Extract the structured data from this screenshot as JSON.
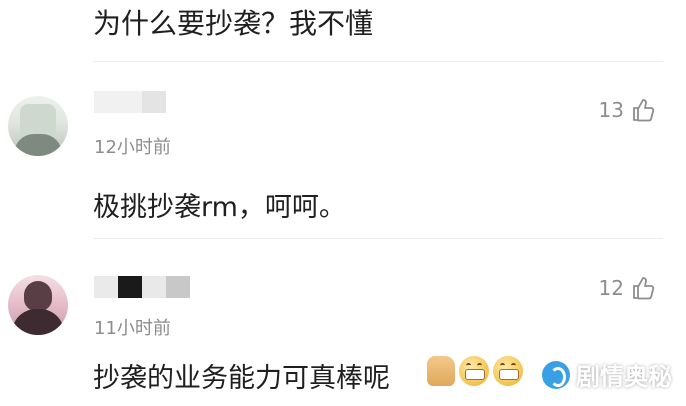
{
  "top_comment": {
    "content": "为什么要抄袭？我不懂"
  },
  "comments": [
    {
      "time": "12小时前",
      "likes": "13",
      "content": "极挑抄袭rm，呵呵。"
    },
    {
      "time": "11小时前",
      "likes": "12",
      "content": "抄袭的业务能力可真棒呢"
    }
  ],
  "icons": {
    "like": "thumbs-up-icon",
    "emoji": [
      "thumbs-up-emoji",
      "grin-emoji",
      "grin-emoji"
    ]
  },
  "watermark": {
    "text": "剧情奥秘"
  },
  "colors": {
    "text": "#1f1f1f",
    "meta": "#8d8d8d",
    "divider": "#ececec"
  }
}
